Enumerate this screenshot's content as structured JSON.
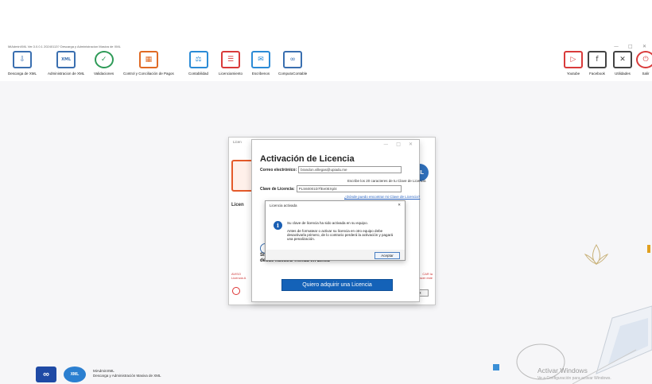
{
  "window": {
    "title": "MiAdminXML Ver.3.0.0.1 20240113? Descarga y Administracion Masiva de XML",
    "controls": [
      "—",
      "□",
      "✕"
    ]
  },
  "toolbar": {
    "left": [
      {
        "label": "Descarga de XML",
        "icon": "download-icon",
        "glyph": "⇩"
      },
      {
        "label": "Administracion de XML",
        "icon": "xml-file-icon",
        "glyph": "XML"
      },
      {
        "label": "Validaciones",
        "icon": "check-circle-icon",
        "glyph": "✓"
      },
      {
        "label": "Control y Conciliación de Pagos",
        "icon": "payments-icon",
        "glyph": "▦"
      },
      {
        "label": "Contabilidad",
        "icon": "accounting-icon",
        "glyph": "⚖"
      },
      {
        "label": "Licenciamiento",
        "icon": "license-icon",
        "glyph": "☰"
      },
      {
        "label": "Escribenos",
        "icon": "chat-icon",
        "glyph": "✉"
      },
      {
        "label": "ComputoContable",
        "icon": "computo-logo-icon",
        "glyph": "∞"
      }
    ],
    "right": [
      {
        "label": "Youtube",
        "icon": "youtube-icon",
        "glyph": "▷"
      },
      {
        "label": "Facebook",
        "icon": "facebook-icon",
        "glyph": "f"
      },
      {
        "label": "Utilidades",
        "icon": "tools-icon",
        "glyph": "✕"
      },
      {
        "label": "Salir",
        "icon": "power-icon",
        "glyph": "⏻"
      }
    ]
  },
  "back_dialog": {
    "title": "Licen",
    "section": "Licen",
    "aviso": "AVISO\nLicencia A",
    "right_note": "CAR la\nracer este",
    "ok": "R"
  },
  "activation": {
    "heading": "Activación de Licencia",
    "email_label": "Correo electrónico:",
    "email_value": "brandon.villegas@upiadu.me",
    "hint": "Escribe los 20 caracteres de tu Clave de Licencia",
    "key_label": "Clave de Licencia:",
    "key_value": "PLS60001D7fEe0EXpl4",
    "key_link": "¿Dónde puedo encontrar mi Clave de Licencia?",
    "notice": "Si no cuentas con una Clave de Licencia, puedes adquirir una desde nuestra Tienda en Línea",
    "buy_button": "Quiero adquirir una Licencia"
  },
  "message": {
    "title": "Licencia activada",
    "close": "✕",
    "line1": "Su clave de licencia ha sido activada en su equipo.",
    "line2": "Antes de formatear o activar su licencia en otro equipo debe desactivarla primero, de lo contrario perderá la activación y pagará una penalización.",
    "ok": "Aceptar"
  },
  "footer": {
    "app_name": "MiAdminXML",
    "app_sub": "Descarga y Administración Masiva de XML",
    "watermark_title": "Activar Windows",
    "watermark_sub": "Ve a Configuración para activar Windows."
  }
}
